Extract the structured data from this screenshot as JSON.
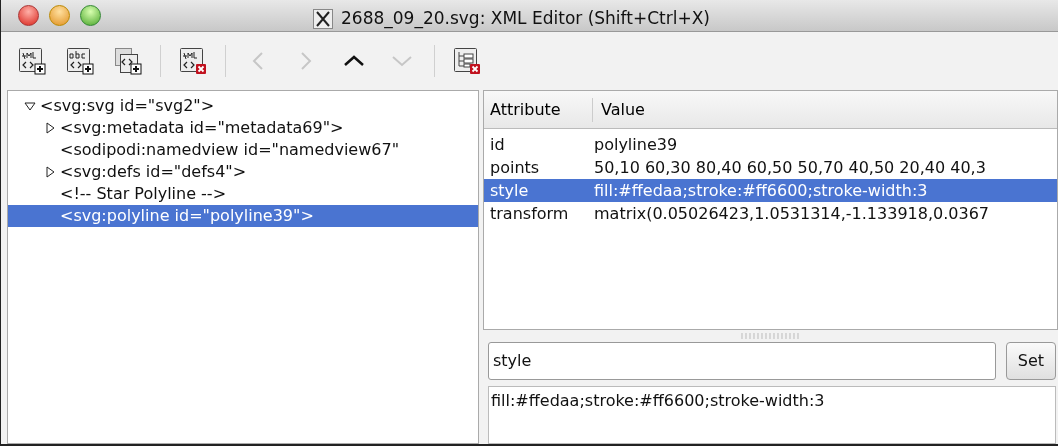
{
  "window": {
    "title": "2688_09_20.svg: XML Editor (Shift+Ctrl+X)"
  },
  "toolbar": [
    {
      "kind": "new-element",
      "disabled": false
    },
    {
      "kind": "new-text",
      "disabled": false
    },
    {
      "kind": "duplicate",
      "disabled": false
    },
    {
      "kind": "separator"
    },
    {
      "kind": "delete-node",
      "disabled": false
    },
    {
      "kind": "separator"
    },
    {
      "kind": "unindent",
      "disabled": true
    },
    {
      "kind": "indent",
      "disabled": true
    },
    {
      "kind": "raise",
      "disabled": false
    },
    {
      "kind": "lower",
      "disabled": true
    },
    {
      "kind": "separator"
    },
    {
      "kind": "delete-attribute",
      "disabled": false
    }
  ],
  "tree": [
    {
      "label": "<svg:svg id=\"svg2\">",
      "expanded": true,
      "selected": false,
      "children": [
        {
          "label": "<svg:metadata id=\"metadata69\">",
          "expanded": false,
          "selected": false
        },
        {
          "label": "<sodipodi:namedview id=\"namedview67\"",
          "selected": false
        },
        {
          "label": "<svg:defs id=\"defs4\">",
          "expanded": false,
          "selected": false
        },
        {
          "label": "<!-- Star Polyline -->",
          "selected": false
        },
        {
          "label": "<svg:polyline id=\"polyline39\">",
          "selected": true
        }
      ]
    }
  ],
  "attributes": {
    "columns": [
      "Attribute",
      "Value"
    ],
    "rows": [
      {
        "name": "id",
        "value": "polyline39",
        "selected": false
      },
      {
        "name": "points",
        "value": "50,10 60,30 80,40 60,50 50,70 40,50 20,40 40,3",
        "selected": false
      },
      {
        "name": "style",
        "value": "fill:#ffedaa;stroke:#ff6600;stroke-width:3",
        "selected": true
      },
      {
        "name": "transform",
        "value": "matrix(0.05026423,1.0531314,-1.133918,0.0367",
        "selected": false
      }
    ]
  },
  "editor": {
    "name": "style",
    "set_button": "Set",
    "value": "fill:#ffedaa;stroke:#ff6600;stroke-width:3"
  }
}
